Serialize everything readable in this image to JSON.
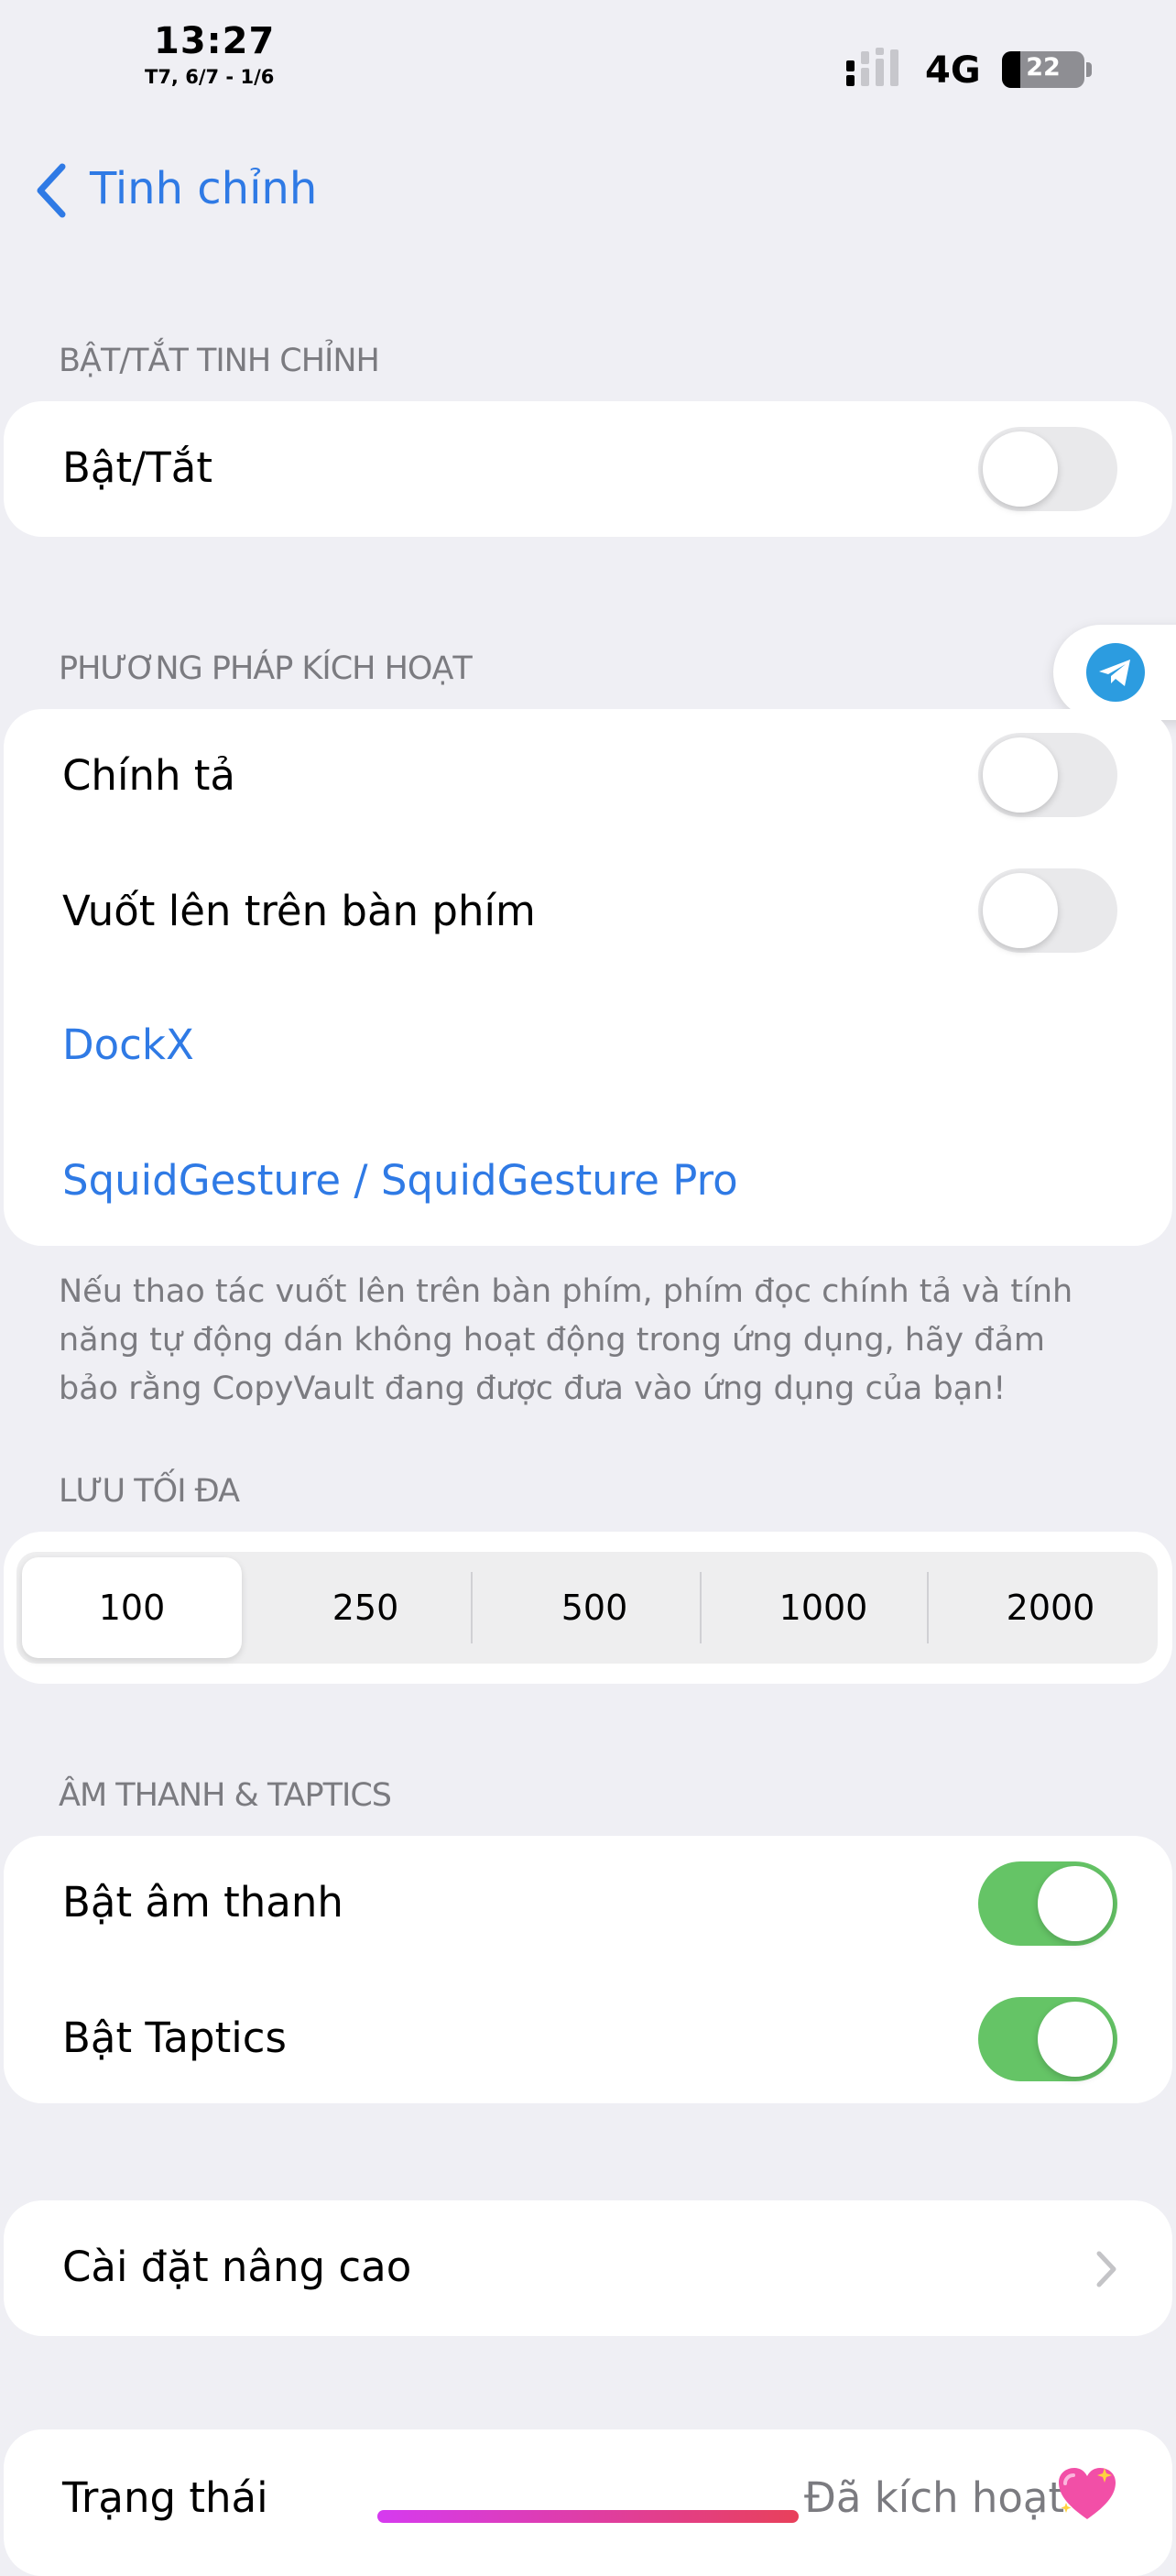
{
  "status_bar": {
    "time": "13:27",
    "date": "T7, 6/7 - 1/6",
    "network": "4G",
    "battery": "22",
    "battery_level": 0.22
  },
  "nav": {
    "back_label": "Tinh chỉnh"
  },
  "sections": {
    "toggle_section": {
      "header": "BẬT/TẮT TINH CHỈNH",
      "row_label": "Bật/Tắt",
      "row_on": false
    },
    "activation": {
      "header": "PHƯƠNG PHÁP KÍCH HOẠT",
      "rows": [
        {
          "label": "Chính tả",
          "on": false
        },
        {
          "label": "Vuốt lên trên bàn phím",
          "on": false
        }
      ],
      "links": [
        "DockX",
        "SquidGesture / SquidGesture Pro"
      ],
      "footnote": "Nếu thao tác vuốt lên trên bàn phím, phím đọc chính tả và tính năng tự động dán không hoạt động trong ứng dụng, hãy đảm bảo rằng CopyVault đang được đưa vào ứng dụng của bạn!"
    },
    "max_save": {
      "header": "LƯU TỐI ĐA",
      "options": [
        "100",
        "250",
        "500",
        "1000",
        "2000"
      ],
      "selected": "100"
    },
    "sound": {
      "header": "ÂM THANH & TAPTICS",
      "rows": [
        {
          "label": "Bật âm thanh",
          "on": true
        },
        {
          "label": "Bật Taptics",
          "on": true
        }
      ]
    },
    "advanced": {
      "label": "Cài đặt nâng cao"
    },
    "status": {
      "label": "Trạng thái",
      "value": "Đã kích hoạt"
    }
  },
  "colors": {
    "accent": "#2f7ae5",
    "toggle_on": "#65c466",
    "background": "#efeff4"
  }
}
